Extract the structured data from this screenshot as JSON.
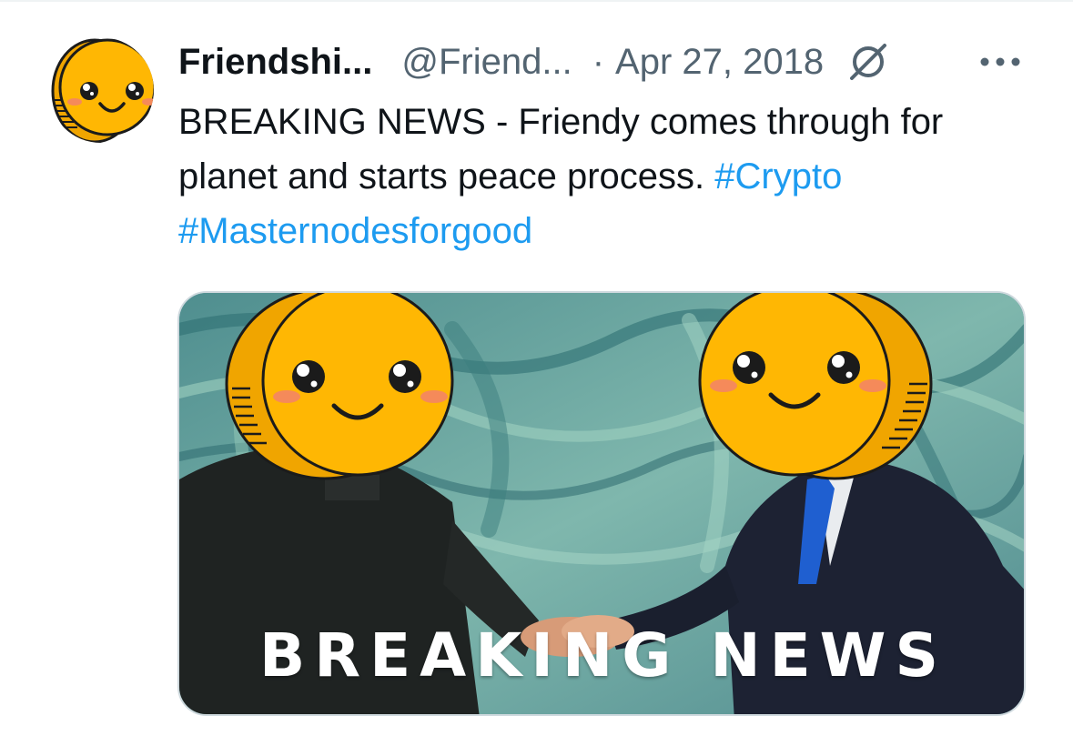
{
  "tweet": {
    "display_name": "Friendshi...",
    "handle": "@Friend...",
    "separator": "·",
    "date": "Apr 27, 2018",
    "text_main": "BREAKING NEWS - Friendy comes through for planet and starts peace process. ",
    "hashtags": [
      "#Crypto",
      "#Masternodesforgood"
    ],
    "media_caption": "BREAKING NEWS"
  },
  "icons": {
    "avatar": "friendy-coin-avatar-icon",
    "grok": "grok-icon",
    "more": "more-options-icon"
  },
  "colors": {
    "link": "#1d9bf0",
    "muted": "#536471",
    "text": "#0f1419",
    "coin": "#ffb703"
  }
}
